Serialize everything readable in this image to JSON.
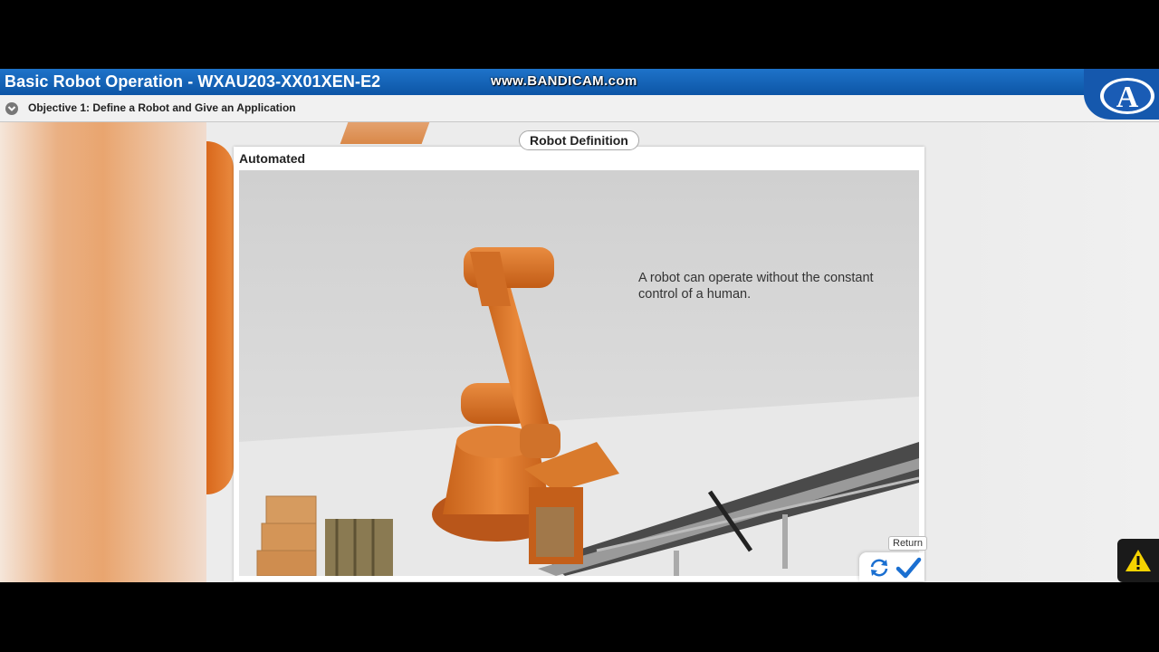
{
  "app": {
    "title": "Basic Robot Operation - WXAU203-XX01XEN-E2",
    "watermark": "www.BANDICAM.com",
    "logo_icon": "amatrol-a-logo"
  },
  "objective": {
    "label": "Objective 1: Define a Robot and Give an Application",
    "toggle_icon": "chevron-down-icon"
  },
  "tab": {
    "label": "Robot Definition"
  },
  "card": {
    "title": "Automated",
    "caption": "A robot can operate without the constant control of a human."
  },
  "controls": {
    "return_label": "Return",
    "replay_icon": "replay-icon",
    "check_icon": "check-icon"
  },
  "alert": {
    "icon": "warning-icon"
  },
  "colors": {
    "title_bar": "#1565c0",
    "robot_orange": "#d9741f",
    "check_blue": "#1a6fd1"
  }
}
